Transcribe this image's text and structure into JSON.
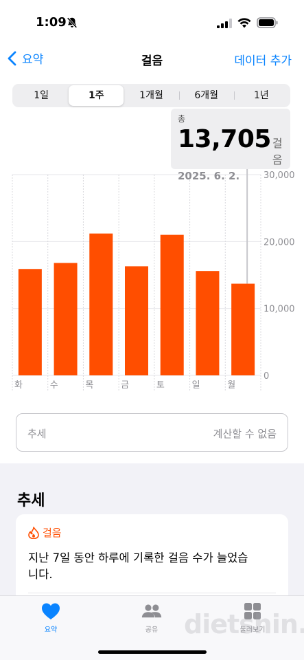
{
  "status": {
    "time": "1:09"
  },
  "nav": {
    "back_label": "요약",
    "title": "걸음",
    "action_label": "데이터 추가"
  },
  "segments": [
    {
      "label": "1일",
      "active": false
    },
    {
      "label": "1주",
      "active": true
    },
    {
      "label": "1개월",
      "active": false
    },
    {
      "label": "6개월",
      "active": false
    },
    {
      "label": "1년",
      "active": false
    }
  ],
  "tooltip": {
    "label": "총",
    "value": "13,705",
    "unit": "걸음",
    "date": "2025. 6. 2."
  },
  "chart_data": {
    "type": "bar",
    "categories": [
      "화",
      "수",
      "목",
      "금",
      "토",
      "일",
      "월"
    ],
    "values": [
      15900,
      16800,
      21200,
      16300,
      21000,
      15600,
      13705
    ],
    "y_ticks": [
      "0",
      "10,000",
      "20,000",
      "30,000"
    ],
    "ylim": [
      0,
      30000
    ],
    "selected_index": 6,
    "bar_color": "#ff4e00"
  },
  "trend_row": {
    "label": "추세",
    "value": "계산할 수 없음"
  },
  "section": {
    "title": "추세"
  },
  "highlight": {
    "category": "걸음",
    "text": "지난 7일 동안 하루에 기록한 걸음 수가 늘었습니다."
  },
  "tabs": [
    {
      "label": "요약"
    },
    {
      "label": "공유"
    },
    {
      "label": "둘러보기"
    }
  ],
  "watermark": "dietshin.com",
  "colors": {
    "accent": "#0a84ff",
    "bar": "#ff4e00"
  }
}
